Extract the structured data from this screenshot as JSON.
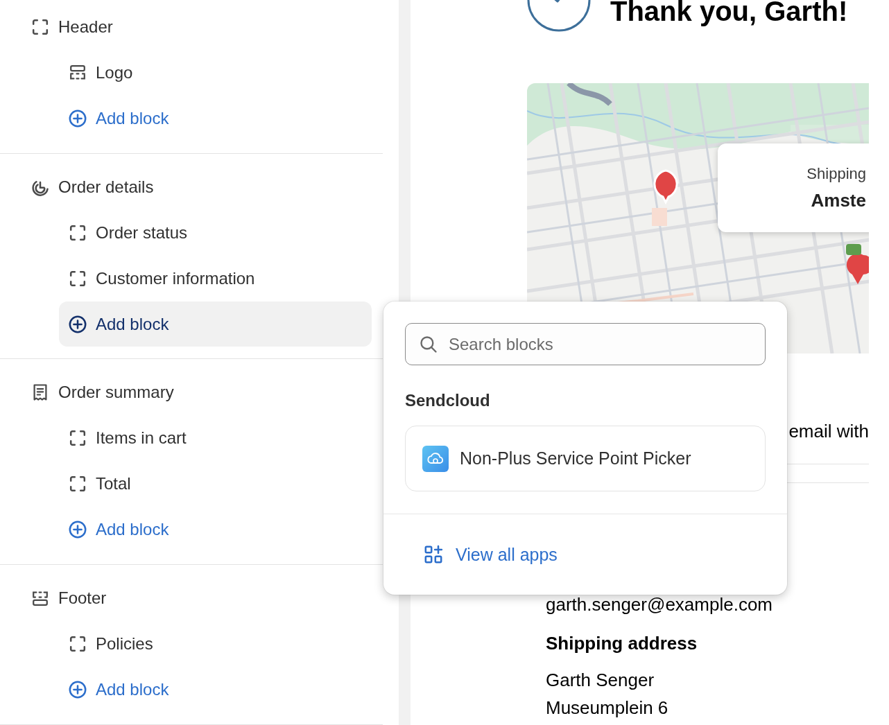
{
  "sidebar": {
    "sections": [
      {
        "title": "Header",
        "kind": "frame",
        "items": [
          {
            "label": "Logo",
            "kind": "logo",
            "selected": false
          },
          {
            "label": "Add block",
            "kind": "add",
            "selected": false
          }
        ]
      },
      {
        "title": "Order details",
        "kind": "radial",
        "items": [
          {
            "label": "Order status",
            "kind": "block",
            "selected": false
          },
          {
            "label": "Customer information",
            "kind": "block",
            "selected": false
          },
          {
            "label": "Add block",
            "kind": "add",
            "selected": true
          }
        ]
      },
      {
        "title": "Order summary",
        "kind": "receipt",
        "items": [
          {
            "label": "Items in cart",
            "kind": "block",
            "selected": false
          },
          {
            "label": "Total",
            "kind": "block",
            "selected": false
          },
          {
            "label": "Add block",
            "kind": "add",
            "selected": false
          }
        ]
      },
      {
        "title": "Footer",
        "kind": "footer",
        "items": [
          {
            "label": "Policies",
            "kind": "block",
            "selected": false
          },
          {
            "label": "Add block",
            "kind": "add",
            "selected": false
          }
        ]
      }
    ]
  },
  "preview": {
    "heading": "Thank you, Garth!",
    "map": {
      "kind": "picture",
      "overlay": {
        "label": "Shipping",
        "value": "Amste"
      }
    },
    "notice_fragment": "email with",
    "contact_email": "garth.senger@example.com",
    "shipping_address": {
      "heading": "Shipping address",
      "lines": [
        "Garth Senger",
        "Museumplein 6"
      ]
    }
  },
  "popover": {
    "search": {
      "placeholder": "Search blocks"
    },
    "groups": [
      {
        "title": "Sendcloud",
        "items": [
          {
            "label": "Non-Plus Service Point Picker"
          }
        ]
      }
    ],
    "footer_link": "View all apps"
  }
}
